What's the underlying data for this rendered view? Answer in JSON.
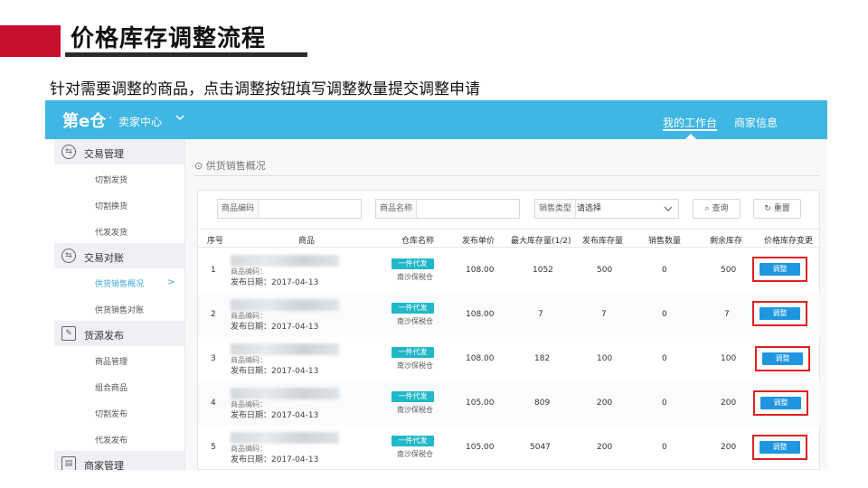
{
  "slide": {
    "title": "价格库存调整流程",
    "subtitle": "针对需要调整的商品，点击调整按钮填写调整数量提交调整申请"
  },
  "app": {
    "brand": "第e仓",
    "brand_dot": "·",
    "brand_sub": "卖家中心",
    "nav_workbench": "我的工作台",
    "nav_merchant": "商家信息",
    "accent_color": "#3fb6e3"
  },
  "sidebar": {
    "groups": [
      {
        "label": "交易管理",
        "icon": "exchange-icon",
        "items": [
          "切割发货",
          "切割换货",
          "代发发货"
        ]
      },
      {
        "label": "交易对账",
        "icon": "exchange-icon",
        "items": [
          "供货销售概况",
          "供货销售对账"
        ]
      },
      {
        "label": "货源发布",
        "icon": "edit-icon",
        "items": [
          "商品管理",
          "组合商品",
          "切割发布",
          "代发发布"
        ]
      },
      {
        "label": "商家管理",
        "icon": "shop-icon",
        "items": []
      }
    ],
    "active_item": "供货销售概况"
  },
  "main": {
    "breadcrumb": "供货销售概况",
    "filters": {
      "code_label": "商品编码",
      "name_label": "商品名称",
      "type_label": "销售类型",
      "type_value": "请选择",
      "search_label": "查询",
      "reset_label": "重置"
    },
    "columns": [
      "序号",
      "商品",
      "仓库名称",
      "发布单价",
      "最大库存量(1/2)",
      "发布库存量",
      "销售数量",
      "剩余库存",
      "价格库存变更"
    ],
    "rows": [
      {
        "no": "1",
        "code_label": "商品编码：",
        "date": "发布日期：2017-04-13",
        "tag": "一件代发",
        "warehouse": "南沙保税仓",
        "price": "108.00",
        "max_stock": "1052",
        "pub_stock": "500",
        "sold": "0",
        "remain": "500",
        "action": "调整"
      },
      {
        "no": "2",
        "code_label": "商品编码：",
        "date": "发布日期：2017-04-13",
        "tag": "一件代发",
        "warehouse": "南沙保税仓",
        "price": "108.00",
        "max_stock": "7",
        "pub_stock": "7",
        "sold": "0",
        "remain": "7",
        "action": "调整"
      },
      {
        "no": "3",
        "code_label": "商品编码：",
        "date": "发布日期：2017-04-13",
        "tag": "一件代发",
        "warehouse": "南沙保税仓",
        "price": "108.00",
        "max_stock": "182",
        "pub_stock": "100",
        "sold": "0",
        "remain": "100",
        "action": "调整"
      },
      {
        "no": "4",
        "code_label": "商品编码：",
        "date": "发布日期：2017-04-13",
        "tag": "一件代发",
        "warehouse": "南沙保税仓",
        "price": "105.00",
        "max_stock": "809",
        "pub_stock": "200",
        "sold": "0",
        "remain": "200",
        "action": "调整"
      },
      {
        "no": "5",
        "code_label": "商品编码：",
        "date": "发布日期：2017-04-13",
        "tag": "一件代发",
        "warehouse": "南沙保税仓",
        "price": "105.00",
        "max_stock": "5047",
        "pub_stock": "200",
        "sold": "0",
        "remain": "200",
        "action": "调整"
      }
    ]
  }
}
